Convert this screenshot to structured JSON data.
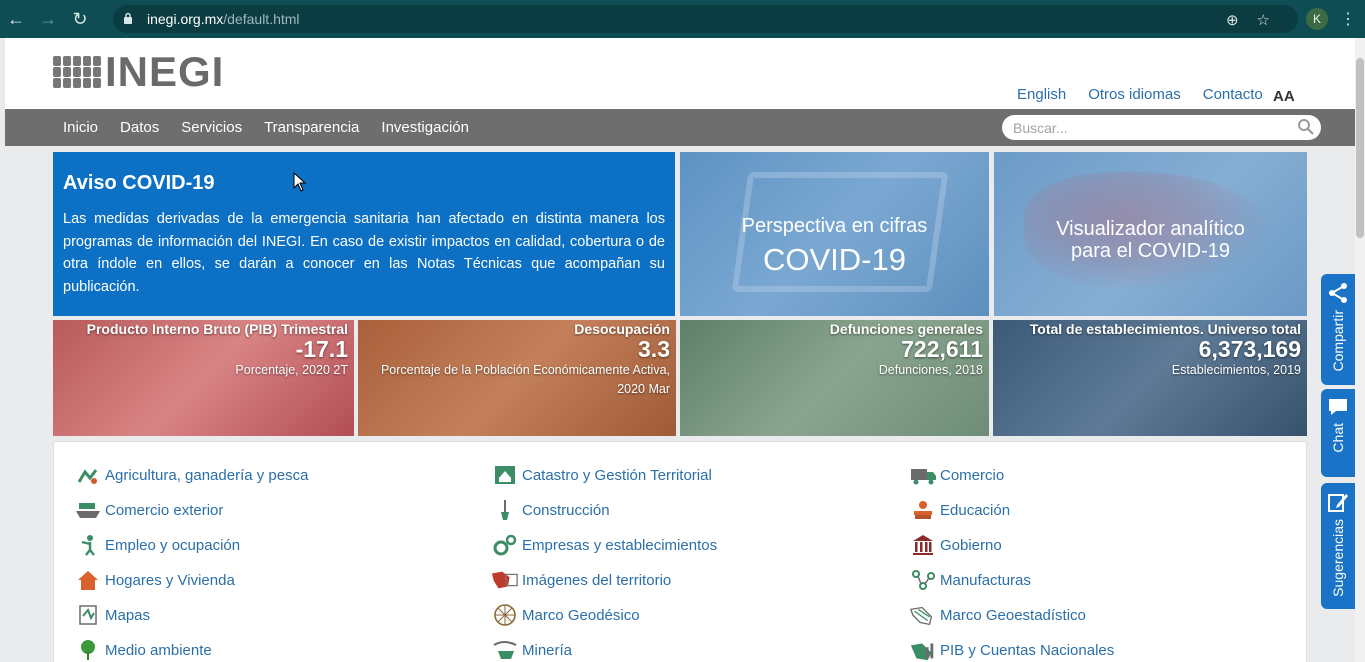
{
  "browser": {
    "url_host": "inegi.org.mx",
    "url_path": "/default.html",
    "profile_initial": "K"
  },
  "header": {
    "logo_text": "INEGI",
    "links": [
      "English",
      "Otros idiomas",
      "Contacto"
    ],
    "font_size_toggle": "AA"
  },
  "nav": {
    "items": [
      "Inicio",
      "Datos",
      "Servicios",
      "Transparencia",
      "Investigación"
    ],
    "search_placeholder": "Buscar..."
  },
  "covid": {
    "title": "Aviso COVID-19",
    "body": "Las medidas derivadas de la emergencia sanitaria han afectado en distinta manera los programas de información del INEGI. En caso de existir impactos en calidad, cobertura o de otra índole en ellos, se darán a conocer en las Notas Técnicas que acompañan su publicación."
  },
  "tiles": {
    "perspectiva_line1": "Perspectiva en cifras",
    "perspectiva_line2": "COVID-19",
    "visualizador_line1": "Visualizador analítico",
    "visualizador_line2": "para el COVID-19"
  },
  "stats": [
    {
      "label": "Producto Interno Bruto (PIB) Trimestral",
      "value": "-17.1",
      "unit": "Porcentaje, 2020 2T"
    },
    {
      "label": "Desocupación",
      "value": "3.3",
      "unit": "Porcentaje de la Población Económicamente Activa, 2020 Mar"
    },
    {
      "label": "Defunciones generales",
      "value": "722,611",
      "unit": "Defunciones, 2018"
    },
    {
      "label": "Total de establecimientos. Universo total",
      "value": "6,373,169",
      "unit": "Establecimientos, 2019"
    }
  ],
  "topics": [
    {
      "label": "Agricultura, ganadería y pesca",
      "icon": "agriculture-icon"
    },
    {
      "label": "Catastro y Gestión Territorial",
      "icon": "cadastre-icon"
    },
    {
      "label": "Comercio",
      "icon": "truck-icon"
    },
    {
      "label": "Comercio exterior",
      "icon": "ship-icon"
    },
    {
      "label": "Construcción",
      "icon": "shovel-icon"
    },
    {
      "label": "Educación",
      "icon": "books-icon"
    },
    {
      "label": "Empleo y ocupación",
      "icon": "worker-icon"
    },
    {
      "label": "Empresas y establecimientos",
      "icon": "gears-icon"
    },
    {
      "label": "Gobierno",
      "icon": "building-icon"
    },
    {
      "label": "Hogares y Vivienda",
      "icon": "house-icon"
    },
    {
      "label": "Imágenes del territorio",
      "icon": "map-images-icon"
    },
    {
      "label": "Manufacturas",
      "icon": "manufacture-icon"
    },
    {
      "label": "Mapas",
      "icon": "map-icon"
    },
    {
      "label": "Marco Geodésico",
      "icon": "globe-icon"
    },
    {
      "label": "Marco Geoestadístico",
      "icon": "geostat-icon"
    },
    {
      "label": "Medio ambiente",
      "icon": "tree-icon"
    },
    {
      "label": "Minería",
      "icon": "mining-icon"
    },
    {
      "label": "PIB y Cuentas Nacionales",
      "icon": "chart-icon"
    }
  ],
  "side_tabs": [
    "Compartir",
    "Chat",
    "Sugerencias"
  ],
  "colors": {
    "chrome": "#0e4d54",
    "covid_blue": "#0c70c4",
    "link_blue": "#2b6fa8",
    "nav_gray": "#6e6e6e",
    "side_tab_blue": "#1a73c6"
  }
}
